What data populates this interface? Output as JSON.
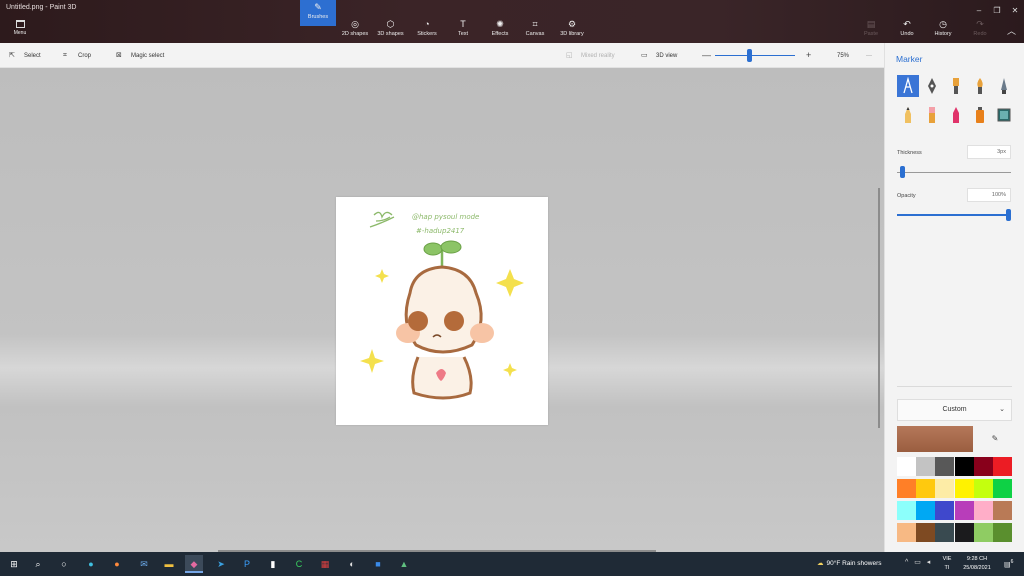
{
  "window": {
    "title": "Untitled.png - Paint 3D",
    "controls": [
      "–",
      "❐",
      "✕"
    ]
  },
  "ribbon": {
    "menu_label": "Menu",
    "tools": [
      {
        "label": "Brushes",
        "glyph": "✎",
        "active": true
      },
      {
        "label": "2D shapes",
        "glyph": "◎"
      },
      {
        "label": "3D shapes",
        "glyph": "⬡"
      },
      {
        "label": "Stickers",
        "glyph": "◔"
      },
      {
        "label": "Text",
        "glyph": "T"
      },
      {
        "label": "Effects",
        "glyph": "✺"
      },
      {
        "label": "Canvas",
        "glyph": "⌗"
      },
      {
        "label": "3D library",
        "glyph": "⚙"
      }
    ],
    "right_tools": [
      {
        "label": "Paste",
        "glyph": "📋",
        "enabled": false
      },
      {
        "label": "Undo",
        "glyph": "↶",
        "enabled": true
      },
      {
        "label": "History",
        "glyph": "◷",
        "enabled": true
      },
      {
        "label": "Redo",
        "glyph": "↷",
        "enabled": false
      }
    ],
    "collapse_glyph": "︿"
  },
  "toolbar": {
    "select_label": "Select",
    "crop_label": "Crop",
    "magic_select_label": "Magic select",
    "mixed_reality_label": "Mixed reality",
    "view3d_label": "3D view",
    "zoom_value": "75%",
    "zoom_minus": "—",
    "zoom_plus": "+",
    "more_glyph": "···",
    "zoom_level": 0.4
  },
  "panel": {
    "title": "Marker",
    "thickness_label": "Thickness",
    "thickness_value": "3px",
    "thickness_level": 0.03,
    "opacity_label": "Opacity",
    "opacity_value": "100%",
    "opacity_level": 1.0,
    "color_mode_label": "Custom",
    "current_color": "#b5785a",
    "palette": [
      "#ffffff",
      "#c3c3c3",
      "#585858",
      "#000000",
      "#88001b",
      "#ec1c24",
      "#ff7f27",
      "#ffc90e",
      "#fdeca6",
      "#fff200",
      "#c4ff0e",
      "#0ed145",
      "#8cfffb",
      "#00a8f3",
      "#3f48cc",
      "#b83dba",
      "#ffaec8",
      "#b97a56",
      "#f7b984",
      "#7e4a22",
      "#394a50",
      "#1b1b1d",
      "#8fcc63",
      "#5a8f2e"
    ]
  },
  "artwork": {
    "handle_text": "@hap pysoul mode",
    "tag_text": "#-hadup2417"
  },
  "taskbar": {
    "weather": "90°F  Rain showers",
    "lang": "VIE",
    "lang_sub": "TI",
    "time": "9:28 CH",
    "date": "25/08/2021",
    "notif_count": "6"
  }
}
